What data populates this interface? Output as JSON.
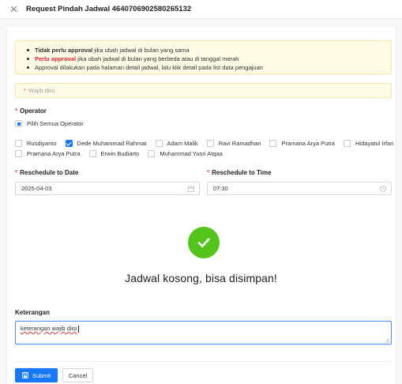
{
  "header": {
    "title": "Request Pindah Jadwal 4640706902580265132"
  },
  "notice": {
    "lines": [
      {
        "bold": "Tidak perlu approval",
        "rest": "jika ubah jadwal di bulan yang sama"
      },
      {
        "bold": "Perlu approval",
        "rest": "jika ubah jadwal di bulan yang berbeda atau di tanggal merah"
      },
      {
        "bold": "",
        "rest": "Approval dilakukan pada halaman detail jadwal, lalu klik detail pada list data pengajuan"
      }
    ]
  },
  "warning": {
    "required_mark": "*",
    "text": "Wajib diisi"
  },
  "operator": {
    "required_mark": "*",
    "label": "Operator",
    "select_all": "Pilih Semua Operator",
    "items": [
      {
        "name": "Rusdiyanto",
        "checked": false
      },
      {
        "name": "Dede Muhammad Rahmat",
        "checked": true
      },
      {
        "name": "Adam Malik",
        "checked": false
      },
      {
        "name": "Ravi Ramadhan",
        "checked": false
      },
      {
        "name": "Pramana Arya Putra",
        "checked": false
      },
      {
        "name": "Hidayatul Irfan",
        "checked": false
      },
      {
        "name": "Pramana Arya Putra",
        "checked": false
      },
      {
        "name": "Erwin Budiarto",
        "checked": false
      },
      {
        "name": "Muhammad Yusri Atqaa",
        "checked": false
      }
    ]
  },
  "reschedule": {
    "date_label": "Reschedule to Date",
    "date_value": "2025-04-03",
    "time_label": "Reschedule to Time",
    "time_value": "07:30",
    "required_mark": "*"
  },
  "result": {
    "message": "Jadwal kosong, bisa disimpan!"
  },
  "keterangan": {
    "label": "Keterangan",
    "value": "keterangan wajib diisi"
  },
  "footer": {
    "submit_label": "Submit",
    "cancel_label": "Cancel"
  },
  "colors": {
    "primary": "#1677ff",
    "success": "#52c41a",
    "required": "#ff4d4f",
    "notice_bg": "#fffbe6",
    "notice_red": "#e8262d"
  }
}
